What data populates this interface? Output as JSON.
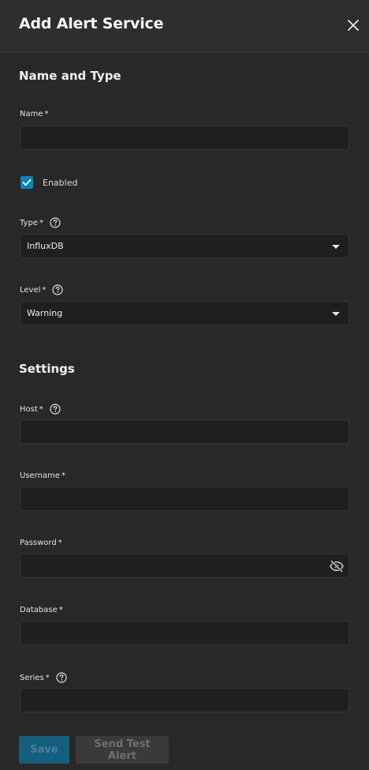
{
  "dialog": {
    "title": "Add Alert Service",
    "close_label": "×"
  },
  "sections": {
    "name_and_type": "Name and Type",
    "settings": "Settings"
  },
  "fields": {
    "name": {
      "label": "Name",
      "required": "*",
      "value": ""
    },
    "enabled": {
      "label": "Enabled",
      "checked": true
    },
    "type": {
      "label": "Type",
      "required": "*",
      "value": "InfluxDB"
    },
    "level": {
      "label": "Level",
      "required": "*",
      "value": "Warning"
    },
    "host": {
      "label": "Host",
      "required": "*",
      "value": ""
    },
    "username": {
      "label": "Username",
      "required": "*",
      "value": ""
    },
    "password": {
      "label": "Password",
      "required": "*",
      "value": ""
    },
    "database": {
      "label": "Database",
      "required": "*",
      "value": ""
    },
    "series": {
      "label": "Series",
      "required": "*",
      "value": ""
    }
  },
  "buttons": {
    "save": "Save",
    "send_test_alert": "Send Test Alert"
  },
  "colors": {
    "background": "#282828",
    "input_background": "#1f1f1f",
    "accent": "#0a85ba",
    "save_disabled": "#125f80",
    "secondary_disabled": "#3a3a3a"
  }
}
